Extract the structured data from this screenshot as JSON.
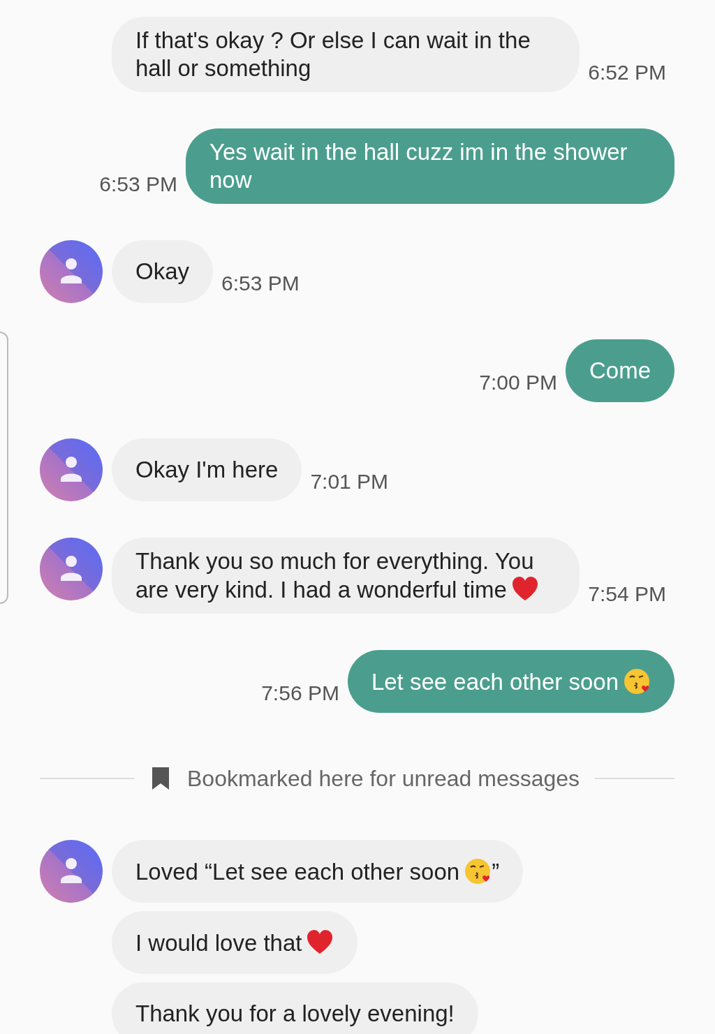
{
  "messages": [
    {
      "kind": "received",
      "avatar": false,
      "parts": [
        {
          "kind": "text",
          "text": "If that's okay ? Or else I can wait in the hall or something"
        }
      ],
      "time": "6:52 PM"
    },
    {
      "kind": "sent",
      "parts": [
        {
          "kind": "text",
          "text": "Yes wait in the hall cuzz im in the shower now"
        }
      ],
      "time": "6:53 PM"
    },
    {
      "kind": "received",
      "avatar": true,
      "parts": [
        {
          "kind": "text",
          "text": "Okay"
        }
      ],
      "time": "6:53 PM"
    },
    {
      "kind": "sent",
      "parts": [
        {
          "kind": "text",
          "text": "Come"
        }
      ],
      "time": "7:00 PM"
    },
    {
      "kind": "received",
      "avatar": true,
      "parts": [
        {
          "kind": "text",
          "text": "Okay I'm here"
        }
      ],
      "time": "7:01 PM"
    },
    {
      "kind": "received",
      "avatar": true,
      "parts": [
        {
          "kind": "text",
          "text": "Thank you so much for everything. You are very kind. I had a wonderful time"
        },
        {
          "kind": "heart"
        }
      ],
      "time": "7:54 PM"
    },
    {
      "kind": "sent",
      "parts": [
        {
          "kind": "text",
          "text": "Let see each other soon"
        },
        {
          "kind": "kiss"
        }
      ],
      "time": "7:56 PM"
    },
    {
      "kind": "divider",
      "text": "Bookmarked here for unread messages"
    },
    {
      "kind": "received",
      "avatar": true,
      "parts": [
        {
          "kind": "text",
          "text": "Loved “Let see each other soon"
        },
        {
          "kind": "kiss"
        },
        {
          "kind": "text",
          "text": "”"
        }
      ]
    },
    {
      "kind": "received",
      "avatar": false,
      "parts": [
        {
          "kind": "text",
          "text": "I would love that"
        },
        {
          "kind": "heart"
        }
      ]
    },
    {
      "kind": "received",
      "avatar": false,
      "parts": [
        {
          "kind": "text",
          "text": "Thank you for a lovely evening!"
        }
      ]
    }
  ]
}
